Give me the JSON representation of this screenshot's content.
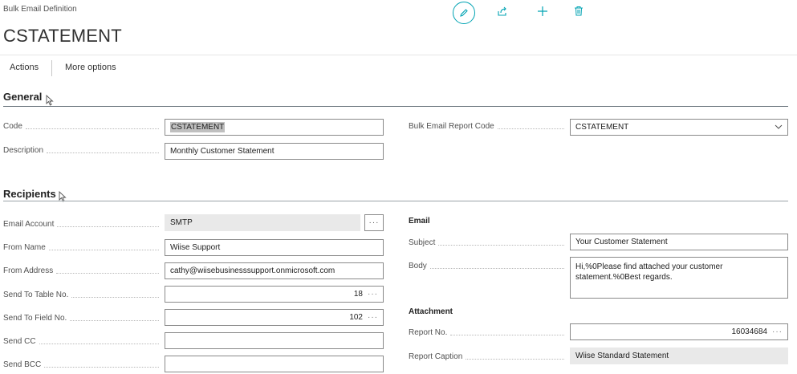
{
  "page": {
    "caption": "Bulk Email Definition",
    "title": "CSTATEMENT"
  },
  "actions": {
    "items": [
      "Actions",
      "More options"
    ]
  },
  "general": {
    "title": "General",
    "code_label": "Code",
    "code_value": "CSTATEMENT",
    "description_label": "Description",
    "description_value": "Monthly Customer Statement",
    "report_code_label": "Bulk Email Report Code",
    "report_code_value": "CSTATEMENT"
  },
  "recipients": {
    "title": "Recipients",
    "email_account_label": "Email Account",
    "email_account_value": "SMTP",
    "from_name_label": "From Name",
    "from_name_value": "Wiise Support",
    "from_address_label": "From Address",
    "from_address_value": "cathy@wiisebusinesssupport.onmicrosoft.com",
    "send_to_table_label": "Send To Table No.",
    "send_to_table_value": "18",
    "send_to_field_label": "Send To Field No.",
    "send_to_field_value": "102",
    "send_cc_label": "Send CC",
    "send_cc_value": "",
    "send_bcc_label": "Send BCC",
    "send_bcc_value": "",
    "email_heading": "Email",
    "subject_label": "Subject",
    "subject_value": "Your Customer Statement",
    "body_label": "Body",
    "body_value": "Hi,%0Please find attached your customer statement.%0Best regards.",
    "attachment_heading": "Attachment",
    "report_no_label": "Report No.",
    "report_no_value": "16034684",
    "report_caption_label": "Report Caption",
    "report_caption_value": "Wiise Standard Statement"
  },
  "lookup_glyph": "···",
  "icons": [
    "edit-icon",
    "share-icon",
    "add-icon",
    "delete-icon",
    "chevron-down-icon",
    "cursor-icon"
  ],
  "colors": {
    "accent": "#00a3b3",
    "rule": "#5f6b73",
    "readonly": "#e9e9e9"
  }
}
